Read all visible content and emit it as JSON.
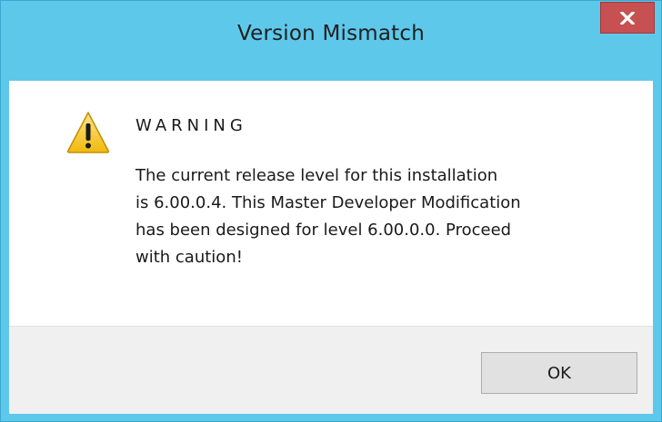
{
  "window": {
    "title": "Version Mismatch",
    "close_icon": "close-icon",
    "accent_color": "#5ec8eb",
    "close_button_color": "#c75050"
  },
  "message": {
    "icon": "warning-icon",
    "heading": "WARNING",
    "body": "The current release level for this installation\nis 6.00.0.4. This Master Developer Modification\nhas been designed for level 6.00.0.0. Proceed\nwith caution!"
  },
  "footer": {
    "ok_label": "OK"
  }
}
